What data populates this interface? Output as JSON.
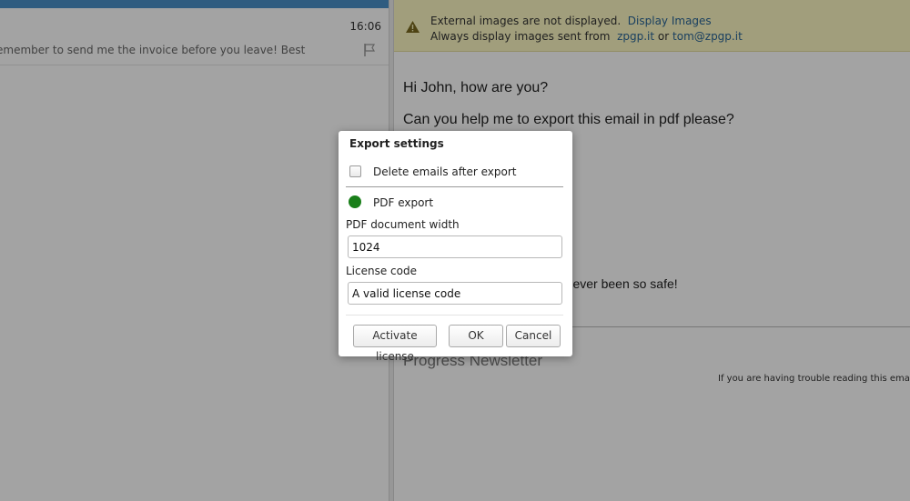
{
  "message_list": {
    "time": "16:06",
    "preview": "emember to send me the invoice before you leave! Best"
  },
  "banner": {
    "text1": "External images are not displayed.",
    "display_link": "Display Images",
    "text2": "Always display images sent from",
    "domain_link": "zpgp.it",
    "or_text": "or",
    "email_link": "tom@zpgp.it"
  },
  "email": {
    "greeting": "Hi John, how are you?",
    "question": "Can you help me to export this email in pdf please?",
    "safe_text": "ve never been so safe!",
    "newsletter": "Progress Newsletter",
    "trouble": "If you are having trouble reading this email,",
    "trouble_link": "rea"
  },
  "dialog": {
    "title": "Export settings",
    "delete_label": "Delete emails after export",
    "delete_checked": false,
    "pdf_label": "PDF export",
    "pdf_status_color": "#1a7f1a",
    "width_label": "PDF document width",
    "width_value": "1024",
    "license_label": "License code",
    "license_value": "A valid license code",
    "activate_label": "Activate license",
    "ok_label": "OK",
    "cancel_label": "Cancel"
  },
  "icons": {
    "flag": "flag-icon",
    "warning": "warning-icon"
  },
  "colors": {
    "accent_bar": "#4a90c8",
    "banner_bg": "#fcf8c2",
    "link": "#2a6496"
  }
}
